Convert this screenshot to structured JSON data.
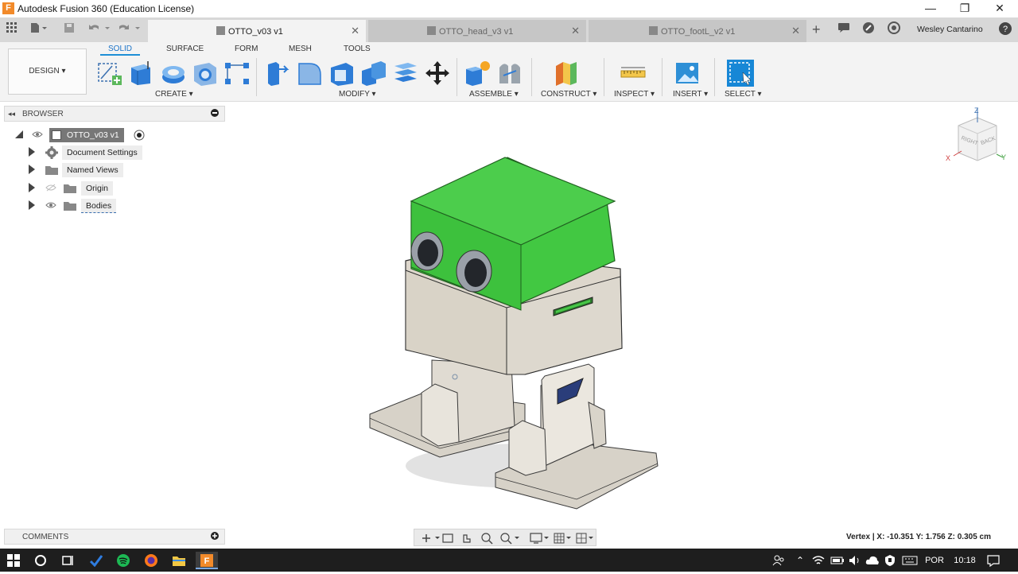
{
  "window": {
    "app_logo": "F",
    "title": "Autodesk Fusion 360 (Education License)",
    "minimize": "—",
    "maximize": "❐",
    "close": "✕"
  },
  "tabs": [
    {
      "label": "OTTO_v03 v1",
      "active": true
    },
    {
      "label": "OTTO_head_v3 v1",
      "active": false
    },
    {
      "label": "OTTO_footL_v2 v1",
      "active": false
    }
  ],
  "user": {
    "name": "Wesley Cantarino"
  },
  "toolbar": {
    "workspace": "DESIGN ▾",
    "mode_tabs": [
      "SOLID",
      "SURFACE",
      "FORM",
      "MESH",
      "TOOLS"
    ],
    "groups": [
      "CREATE ▾",
      "MODIFY ▾",
      "ASSEMBLE ▾",
      "CONSTRUCT ▾",
      "INSPECT ▾",
      "INSERT ▾",
      "SELECT ▾"
    ]
  },
  "browser": {
    "title": "BROWSER",
    "root": "OTTO_v03 v1",
    "items": [
      "Document Settings",
      "Named Views",
      "Origin",
      "Bodies"
    ]
  },
  "viewcube": {
    "top": "Z",
    "front": "RIGHT",
    "side": "BACK",
    "x": "X",
    "y": "Y"
  },
  "comments": {
    "title": "COMMENTS"
  },
  "status": {
    "vertex": "Vertex | X: -10.351 Y: 1.756 Z: 0.305 cm"
  },
  "taskbar": {
    "lang": "POR",
    "time": "10:18"
  },
  "colors": {
    "accent": "#1e8fd6",
    "head": "#3fc63f",
    "body": "#ddd7cc",
    "taskbar": "#1e1e1e"
  }
}
